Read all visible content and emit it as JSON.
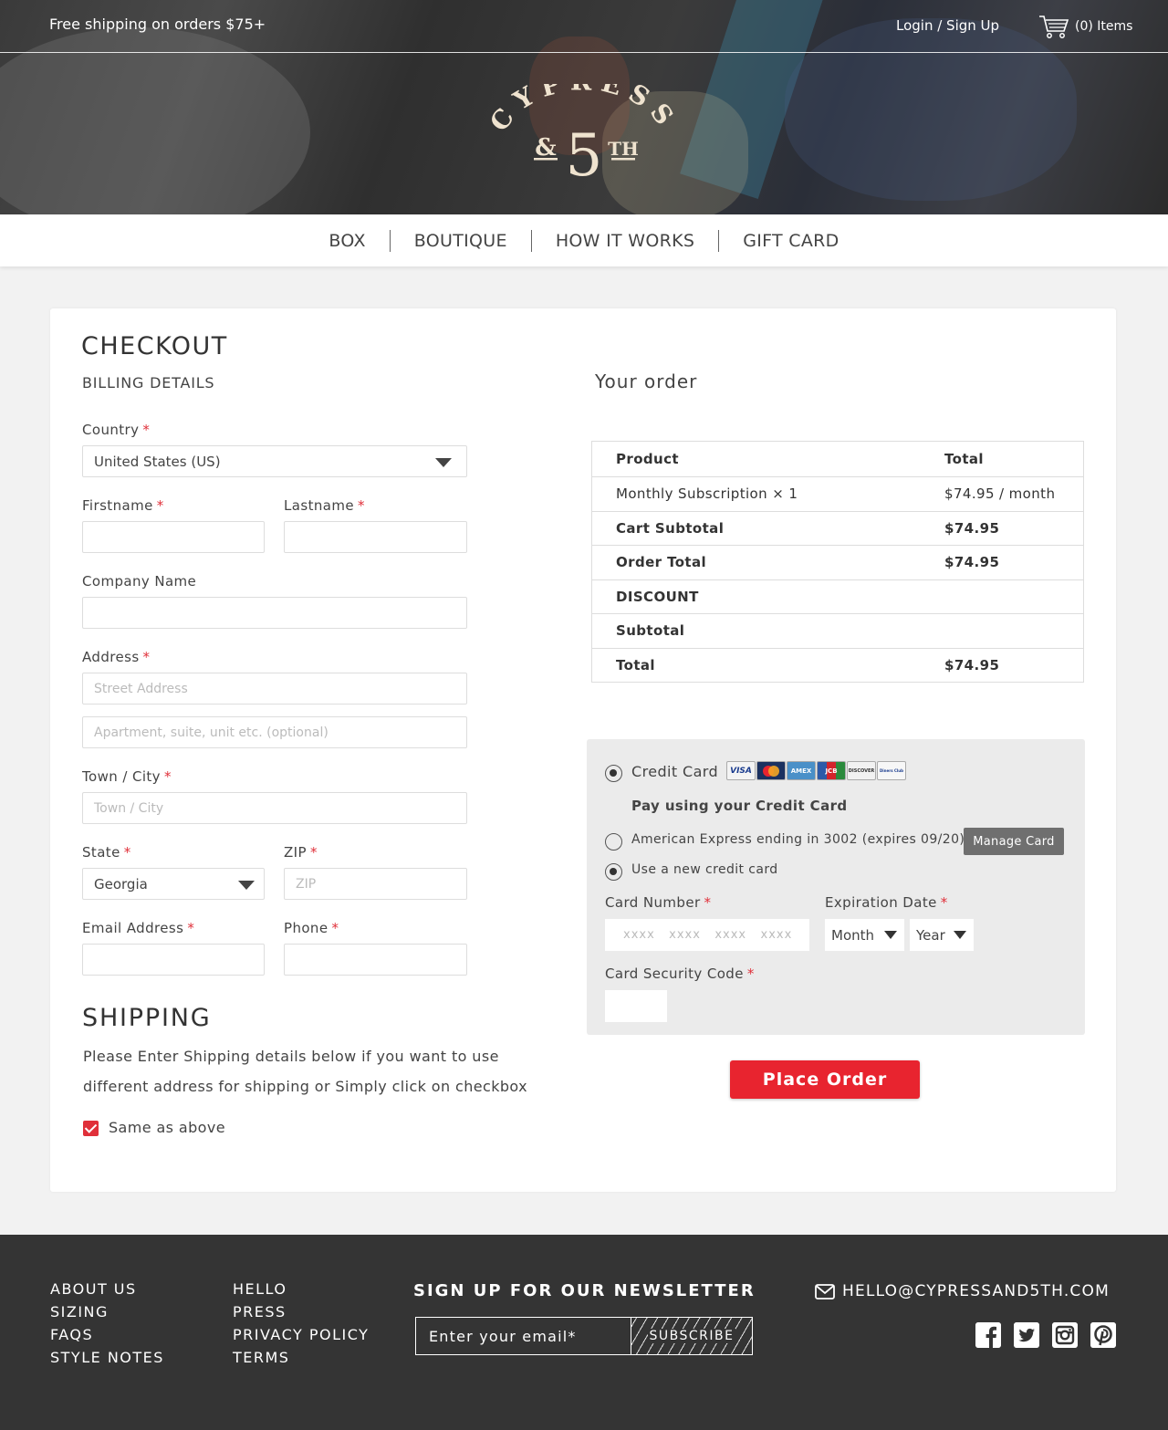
{
  "topbar": {
    "shipping_note": "Free shipping on orders $75+",
    "login": "Login / Sign Up",
    "cart_count": "(0) Items"
  },
  "logo": {
    "line1": "CYPRESS",
    "amp": "&",
    "num": "5",
    "suffix": "TH"
  },
  "nav": [
    "BOX",
    "BOUTIQUE",
    "HOW IT WORKS",
    "GIFT CARD"
  ],
  "checkout": {
    "title": "CHECKOUT",
    "billing_title": "BILLING DETAILS",
    "country_label": "Country",
    "country_value": "United States (US)",
    "firstname_label": "Firstname",
    "lastname_label": "Lastname",
    "company_label": "Company Name",
    "address_label": "Address",
    "street_placeholder": "Street Address",
    "apt_placeholder": "Apartment, suite, unit etc. (optional)",
    "city_label": "Town / City",
    "city_placeholder": "Town / City",
    "state_label": "State",
    "state_value": "Georgia",
    "zip_label": "ZIP",
    "zip_placeholder": "ZIP",
    "email_label": "Email Address",
    "phone_label": "Phone",
    "required_mark": "*"
  },
  "shipping": {
    "title": "SHIPPING",
    "text": "Please Enter Shipping details below if you want to use different address for shipping or Simply click on checkbox",
    "same_label": "Same as above",
    "same_checked": true
  },
  "order": {
    "title": "Your order",
    "header": {
      "product": "Product",
      "total": "Total"
    },
    "rows": [
      {
        "label": "Monthly Subscription × 1",
        "value": "$74.95 / month",
        "bold": false
      },
      {
        "label": "Cart Subtotal",
        "value": "$74.95",
        "bold": true
      },
      {
        "label": "Order Total",
        "value": "$74.95",
        "bold": true
      },
      {
        "label": "DISCOUNT",
        "value": "",
        "bold": true
      },
      {
        "label": "Subtotal",
        "value": "",
        "bold": true
      },
      {
        "label": "Total",
        "value": "$74.95",
        "bold": true
      }
    ]
  },
  "payment": {
    "method_label": "Credit Card",
    "card_brands": [
      "VISA",
      "MC",
      "AMEX",
      "JCB",
      "DISCOVER",
      "Diners Club"
    ],
    "pay_heading": "Pay using your Credit Card",
    "saved_card": "American Express ending in 3002 (expires 09/20)",
    "manage_label": "Manage Card",
    "new_card": "Use a new credit card",
    "card_number_label": "Card Number",
    "card_number_placeholder": "xxxx   xxxx   xxxx   xxxx",
    "expiration_label": "Expiration Date",
    "month_value": "Month",
    "year_value": "Year",
    "security_label": "Card Security Code",
    "place_order": "Place Order"
  },
  "footer": {
    "col1": [
      "ABOUT US",
      "SIZING",
      "FAQS",
      "STYLE NOTES"
    ],
    "col2": [
      "HELLO",
      "PRESS",
      "PRIVACY POLICY",
      "TERMS"
    ],
    "newsletter_title": "SIGN UP FOR OUR NEWSLETTER",
    "newsletter_placeholder": "Enter your email*",
    "subscribe": "SUBSCRIBE",
    "email": "HELLO@CYPRESSAND5TH.COM",
    "social": [
      "facebook-icon",
      "twitter-icon",
      "instagram-icon",
      "pinterest-icon"
    ]
  },
  "colors": {
    "accent": "#e8242f",
    "footer_bg": "#343434",
    "logo": "#efe3cf"
  }
}
